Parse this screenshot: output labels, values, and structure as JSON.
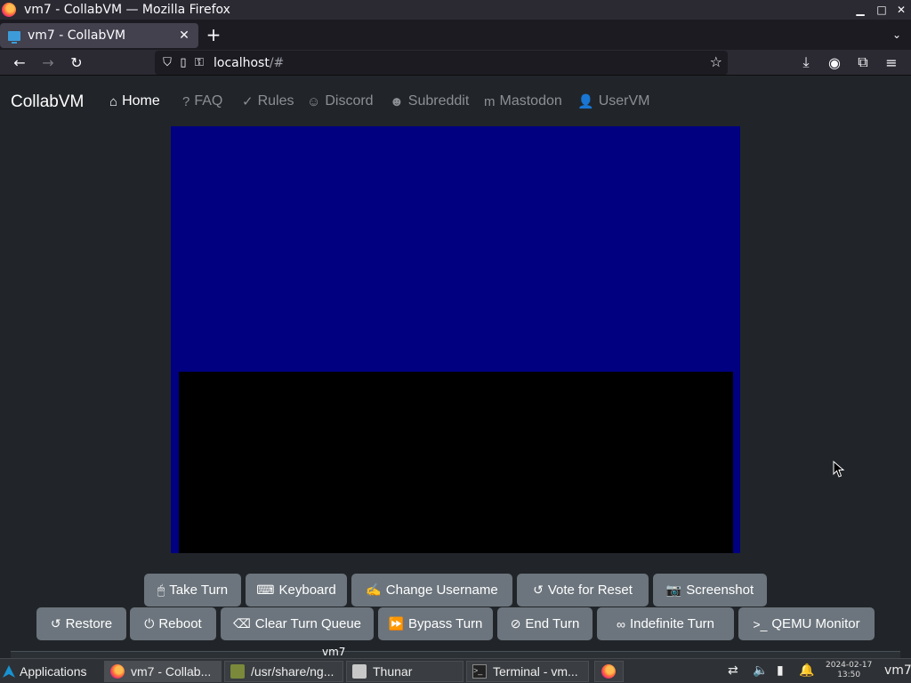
{
  "window": {
    "title": "vm7 - CollabVM — Mozilla Firefox",
    "minimize": "▁",
    "maximize": "□",
    "close": "✕"
  },
  "browser": {
    "tab_label": "vm7 - CollabVM",
    "tab_close": "✕",
    "new_tab": "+",
    "list_tabs": "⌄",
    "url_host": "localhost",
    "url_path": "/#",
    "back": "←",
    "forward": "→",
    "reload": "↻",
    "bookmark": "☆",
    "download": "⤓",
    "account": "◉",
    "extensions": "⧉",
    "menu": "≡"
  },
  "site": {
    "brand": "CollabVM",
    "nav": [
      {
        "label": "Home",
        "icon": "⌂"
      },
      {
        "label": "FAQ",
        "icon": "?"
      },
      {
        "label": "Rules",
        "icon": "✓"
      },
      {
        "label": "Discord",
        "icon": "☺"
      },
      {
        "label": "Subreddit",
        "icon": "☻"
      },
      {
        "label": "Mastodon",
        "icon": "m"
      },
      {
        "label": "UserVM",
        "icon": "👤"
      }
    ],
    "vm_tab_label": "vm7"
  },
  "controls": {
    "row1": [
      {
        "label": "Take Turn",
        "icon": "🖱"
      },
      {
        "label": "Keyboard",
        "icon": "⌨"
      },
      {
        "label": "Change Username",
        "icon": "✍"
      },
      {
        "label": "Vote for Reset",
        "icon": "↺"
      },
      {
        "label": "Screenshot",
        "icon": "📷"
      }
    ],
    "row2": [
      {
        "label": "Restore",
        "icon": "↺"
      },
      {
        "label": "Reboot",
        "icon": "⏻"
      },
      {
        "label": "Clear Turn Queue",
        "icon": "⌫"
      },
      {
        "label": "Bypass Turn",
        "icon": "⏩"
      },
      {
        "label": "End Turn",
        "icon": "⊘"
      },
      {
        "label": "Indefinite Turn",
        "icon": "∞"
      },
      {
        "label": "QEMU Monitor",
        "icon": ">_"
      }
    ]
  },
  "taskbar": {
    "applications": "Applications",
    "windows": [
      {
        "label": "vm7 - Collab..."
      },
      {
        "label": "/usr/share/ng..."
      },
      {
        "label": "Thunar"
      },
      {
        "label": "Terminal - vm..."
      }
    ],
    "date": "2024-02-17",
    "time": "13:50",
    "user": "vm7"
  },
  "colors": {
    "vm_background": "#000080",
    "button": "#6c757d",
    "page_bg": "#212529"
  }
}
